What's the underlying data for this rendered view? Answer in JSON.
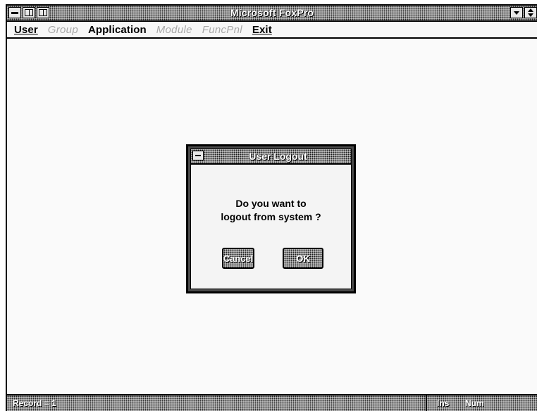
{
  "window": {
    "title": "Microsoft FoxPro"
  },
  "menubar": {
    "items": [
      {
        "label": "User",
        "enabled": true
      },
      {
        "label": "Group",
        "enabled": false
      },
      {
        "label": "Application",
        "enabled": true
      },
      {
        "label": "Module",
        "enabled": false
      },
      {
        "label": "FuncPnl",
        "enabled": false
      },
      {
        "label": "Exit",
        "enabled": true
      }
    ]
  },
  "dialog": {
    "title": "User Logout",
    "message_line1": "Do you want to",
    "message_line2": "logout from system ?",
    "cancel_label": "Cancel",
    "ok_label": "OK"
  },
  "statusbar": {
    "record": "Record = 1",
    "ins": "Ins",
    "num": "Num"
  }
}
